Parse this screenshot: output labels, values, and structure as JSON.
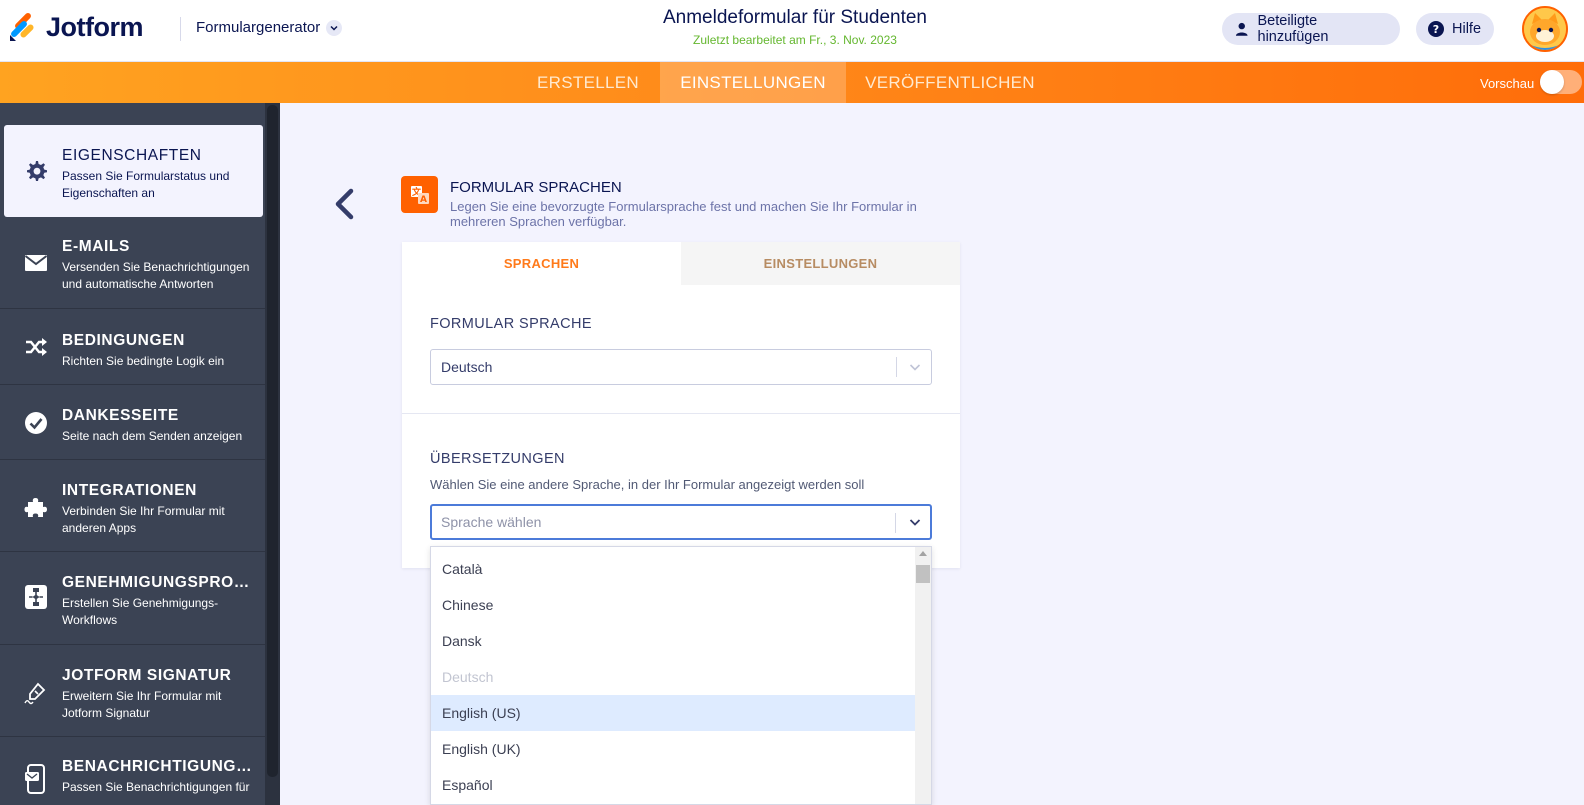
{
  "brand": {
    "name": "Jotform",
    "orange": "#ff6100",
    "navy": "#0a1551"
  },
  "header": {
    "app_switcher": "Formulargenerator",
    "form_title": "Anmeldeformular für Studenten",
    "last_edited": "Zuletzt bearbeitet am Fr., 3. Nov. 2023",
    "add_participants": "Beteiligte hinzufügen",
    "help": "Hilfe"
  },
  "nav": {
    "tabs": [
      {
        "label": "ERSTELLEN",
        "active": false
      },
      {
        "label": "EINSTELLUNGEN",
        "active": true
      },
      {
        "label": "VERÖFFENTLICHEN",
        "active": false
      }
    ],
    "preview_label": "Vorschau"
  },
  "sidebar": {
    "items": [
      {
        "title": "EIGENSCHAFTEN",
        "desc": "Passen Sie Formularstatus und Eigenschaften an",
        "icon": "gear-icon",
        "active": true
      },
      {
        "title": "E-MAILS",
        "desc": "Versenden Sie Benachrichtigungen und automatische Antworten",
        "icon": "envelope-icon"
      },
      {
        "title": "BEDINGUNGEN",
        "desc": "Richten Sie bedingte Logik ein",
        "icon": "shuffle-icon"
      },
      {
        "title": "DANKESSEITE",
        "desc": "Seite nach dem Senden anzeigen",
        "icon": "check-circle-icon"
      },
      {
        "title": "INTEGRATIONEN",
        "desc": "Verbinden Sie Ihr Formular mit anderen Apps",
        "icon": "puzzle-icon"
      },
      {
        "title": "GENEHMIGUNGSPROZ...",
        "desc": "Erstellen Sie Genehmigungs-Workflows",
        "icon": "workflow-icon"
      },
      {
        "title": "JOTFORM SIGNATUR",
        "desc": "Erweitern Sie Ihr Formular mit Jotform Signatur",
        "icon": "pen-icon"
      },
      {
        "title": "BENACHRICHTIGUNGEN",
        "desc": "Passen Sie Benachrichtigungen für",
        "icon": "mobile-icon"
      }
    ]
  },
  "panel": {
    "title": "FORMULAR SPRACHEN",
    "desc": "Legen Sie eine bevorzugte Formularsprache fest und machen Sie Ihr Formular in mehreren Sprachen verfügbar.",
    "tabs": [
      "SPRACHEN",
      "EINSTELLUNGEN"
    ],
    "form_language_label": "FORMULAR SPRACHE",
    "form_language_value": "Deutsch",
    "translations_label": "ÜBERSETZUNGEN",
    "translations_help": "Wählen Sie eine andere Sprache, in der Ihr Formular angezeigt werden soll",
    "translations_placeholder": "Sprache wählen"
  },
  "dropdown": {
    "options": [
      {
        "label": "Català"
      },
      {
        "label": "Chinese"
      },
      {
        "label": "Dansk"
      },
      {
        "label": "Deutsch",
        "disabled": true
      },
      {
        "label": "English (US)",
        "highlighted": true
      },
      {
        "label": "English (UK)"
      },
      {
        "label": "Español"
      }
    ]
  }
}
